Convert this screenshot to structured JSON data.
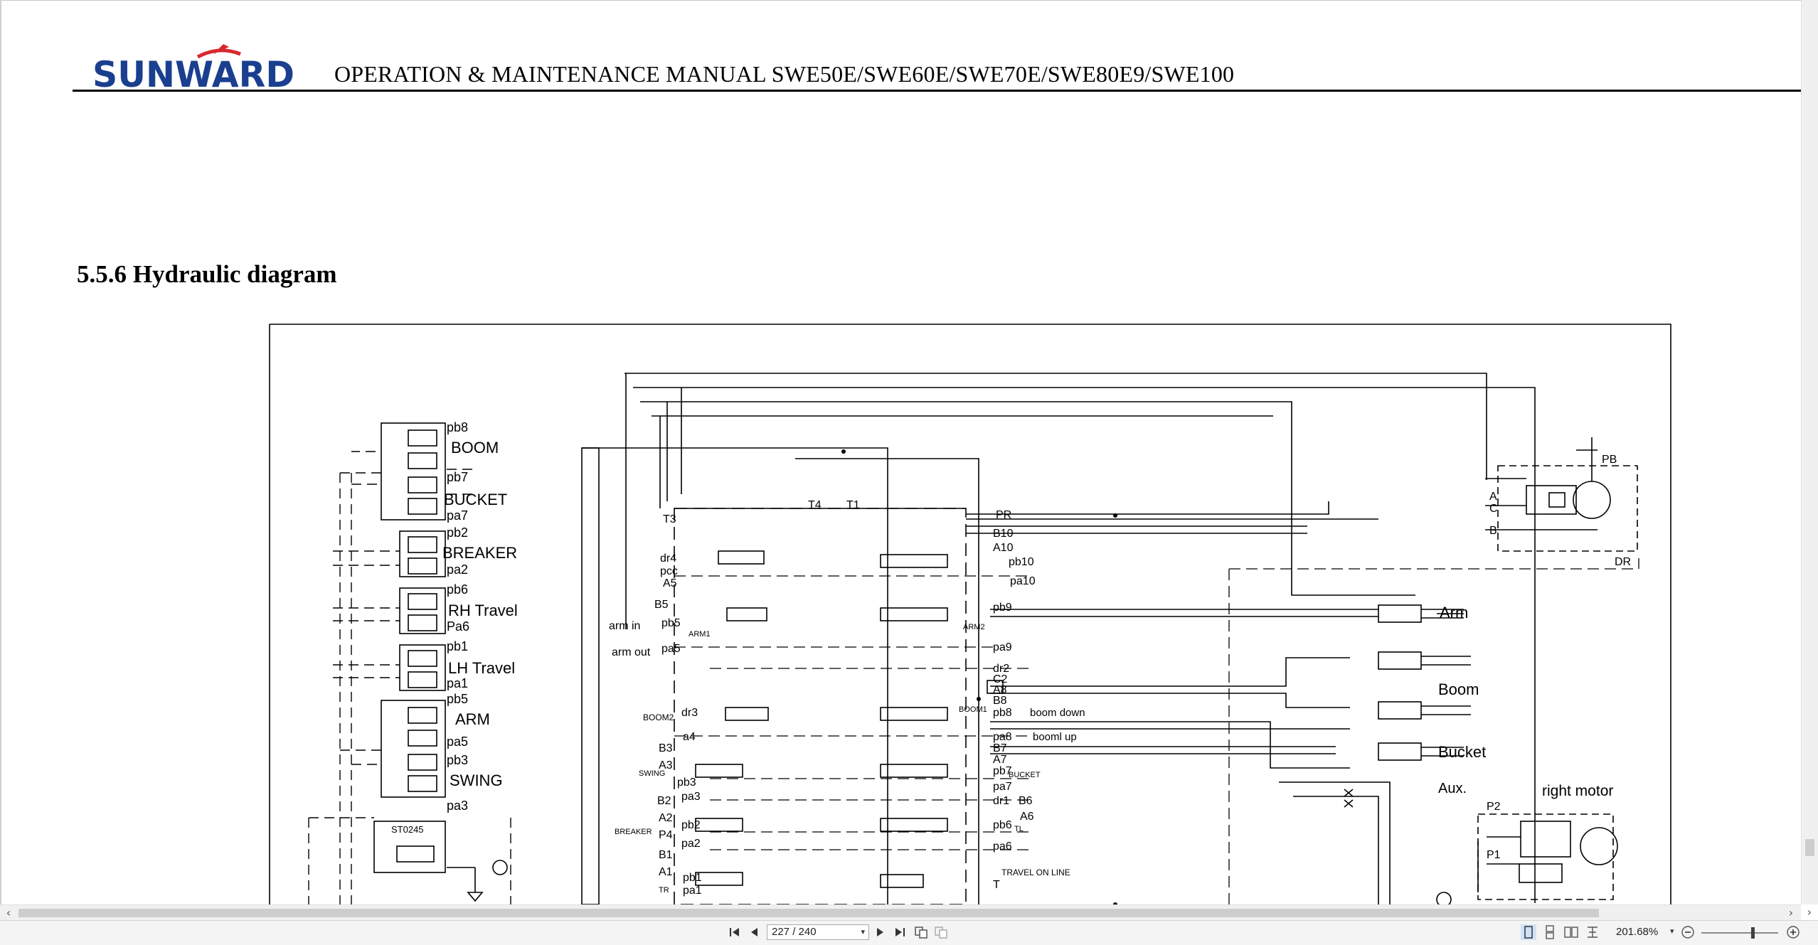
{
  "document": {
    "brand": "SUNWARD",
    "header_title": "OPERATION & MAINTENANCE MANUAL SWE50E/SWE60E/SWE70E/SWE80E9/SWE100",
    "section_heading": "5.5.6 Hydraulic diagram"
  },
  "diagram": {
    "pilot_valve_labels": [
      "pb8",
      "BOOM",
      "pb7",
      "BUCKET",
      "pa7",
      "pb2",
      "BREAKER",
      "pa2",
      "pb6",
      "RH  Travel",
      "Pa6",
      "pb1",
      "LH  Travel",
      "pa1",
      "pb5",
      "ARM",
      "pa5",
      "pb3",
      "SWING",
      "pa3",
      "ST0245"
    ],
    "valve_ports_left": [
      "T3",
      "T4",
      "T1",
      "dr4",
      "pcc",
      "A5",
      "B5",
      "arm  in",
      "pb5",
      "ARM1",
      "arm  out",
      "pa5",
      "BOOM2",
      "dr3",
      "a4",
      "B3",
      "SWING",
      "A3",
      "pb3",
      "B2",
      "pa3",
      "BREAKER",
      "A2",
      "pb2",
      "P4",
      "pa2",
      "B1",
      "A1",
      "TR",
      "pb1",
      "pa1"
    ],
    "valve_ports_right": [
      "PR",
      "B10",
      "A10",
      "pb10",
      "pa10",
      "pb9",
      "ARM2",
      "pa9",
      "dr2",
      "C2",
      "A8",
      "B8",
      "BOOM1",
      "pb8",
      "boom  down",
      "pa8",
      "booml  up",
      "B7",
      "A7",
      "pb7",
      "BUCKET",
      "pa7",
      "dr1",
      "B6",
      "A6",
      "pb6",
      "TL",
      "pa6",
      "TRAVEL  ON  LINE",
      "T"
    ],
    "swing_motor_labels": [
      "PB",
      "A",
      "C",
      "B",
      "DR"
    ],
    "cylinder_labels": [
      "Arm",
      "Boom",
      "Bucket",
      "Aux."
    ],
    "travel_motor_labels": [
      "right  motor",
      "P2",
      "P1"
    ]
  },
  "navigation": {
    "page_indicator": "227 / 240",
    "zoom_level": "201.68%"
  }
}
